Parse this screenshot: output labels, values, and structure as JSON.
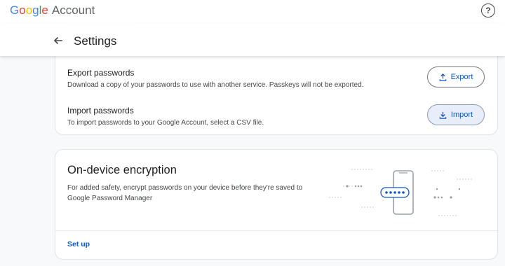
{
  "header": {
    "logo": "Google",
    "logo_suffix": "Account",
    "help_icon": "?",
    "back_icon": "arrow-back-icon",
    "title": "Settings"
  },
  "export": {
    "title": "Export passwords",
    "description": "Download a copy of your passwords to use with another service. Passkeys will not be exported.",
    "button_label": "Export",
    "button_icon": "upload-icon"
  },
  "import": {
    "title": "Import passwords",
    "description": "To import passwords to your Google Account, select a CSV file.",
    "button_label": "Import",
    "button_icon": "download-icon"
  },
  "encryption": {
    "title": "On-device encryption",
    "description": "For added safety, encrypt passwords on your device before they're saved to Google Password Manager",
    "action_label": "Set up",
    "illustration_icon": "phone-encryption-illustration"
  },
  "colors": {
    "accent": "#0b57d0",
    "background": "#f8f9fa",
    "card": "#ffffff"
  }
}
